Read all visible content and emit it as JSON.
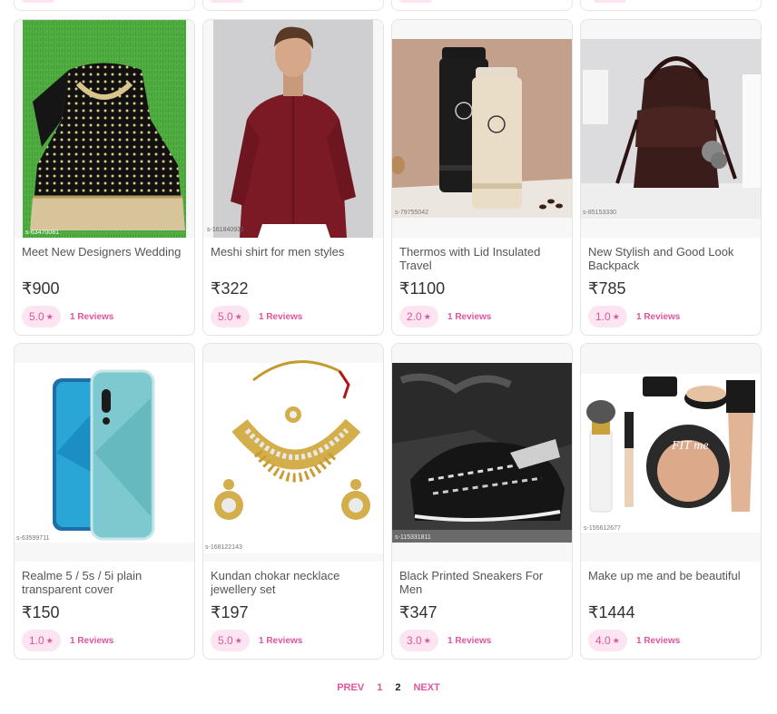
{
  "colors": {
    "accent": "#e0559c",
    "pill_bg": "#fce4f1",
    "border": "#e3e3e3"
  },
  "products": [
    {
      "title": "Meet New Designers Wedding",
      "price": "₹900",
      "rating": "5.0",
      "reviews": "1 Reviews",
      "image": "black-embroidered-lehenga",
      "code": "s-63470081"
    },
    {
      "title": "Meshi shirt for men styles",
      "price": "₹322",
      "rating": "5.0",
      "reviews": "1 Reviews",
      "image": "maroon-shirt-model",
      "code": "s-161840931"
    },
    {
      "title": "Thermos with Lid Insulated Travel",
      "price": "₹1100",
      "rating": "2.0",
      "reviews": "1 Reviews",
      "image": "thermos-bottles",
      "code": "s-79755042"
    },
    {
      "title": "New Stylish and Good Look Backpack",
      "price": "₹785",
      "rating": "1.0",
      "reviews": "1 Reviews",
      "image": "brown-backpack",
      "code": "s-85153330"
    },
    {
      "title": "Realme 5 / 5s / 5i plain transparent cover",
      "price": "₹150",
      "rating": "1.0",
      "reviews": "1 Reviews",
      "image": "transparent-phone-cover",
      "code": "s-63599711"
    },
    {
      "title": "Kundan chokar necklace jewellery set",
      "price": "₹197",
      "rating": "5.0",
      "reviews": "1 Reviews",
      "image": "kundan-necklace-set",
      "code": "s-168122143"
    },
    {
      "title": "Black Printed Sneakers For Men",
      "price": "₹347",
      "rating": "3.0",
      "reviews": "1 Reviews",
      "image": "black-sneakers",
      "code": "s-115331811"
    },
    {
      "title": "Make up me and be beautiful",
      "price": "₹1444",
      "rating": "4.0",
      "reviews": "1 Reviews",
      "image": "makeup-kit",
      "code": "s-155612677"
    }
  ],
  "pagination": {
    "prev": "PREV",
    "pages": [
      "1",
      "2"
    ],
    "current": "2",
    "next": "NEXT"
  }
}
